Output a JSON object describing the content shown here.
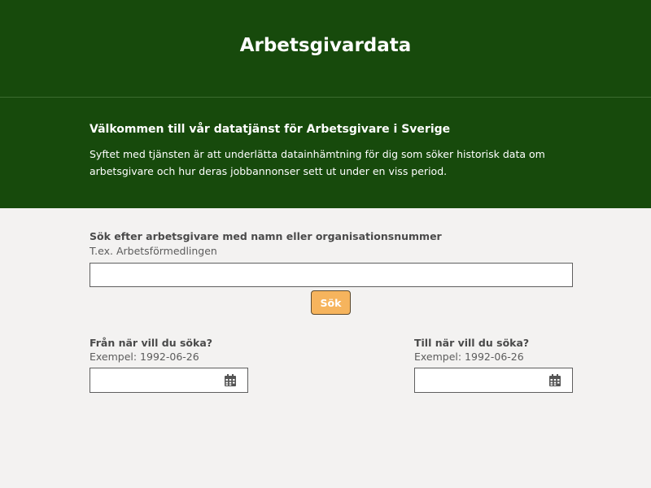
{
  "header": {
    "title": "Arbetsgivardata"
  },
  "intro": {
    "heading": "Välkommen till vår datatjänst för Arbetsgivare i Sverige",
    "body": "Syftet med tjänsten är att underlätta datainhämtning för dig som söker historisk data om arbetsgivare och hur deras jobbannonser sett ut under en viss period."
  },
  "search": {
    "label": "Sök efter arbetsgivare med namn eller organisationsnummer",
    "hint": "T.ex. Arbetsförmedlingen",
    "value": "",
    "button_label": "Sök"
  },
  "date_from": {
    "label": "Från när vill du söka?",
    "hint": "Exempel: 1992-06-26",
    "value": "",
    "icon": "calendar-icon"
  },
  "date_to": {
    "label": "Till när vill du söka?",
    "hint": "Exempel: 1992-06-26",
    "value": "",
    "icon": "calendar-icon"
  },
  "colors": {
    "header_bg": "#174a0c",
    "page_bg": "#f3f2f1",
    "button_bg": "#f6b45d"
  }
}
